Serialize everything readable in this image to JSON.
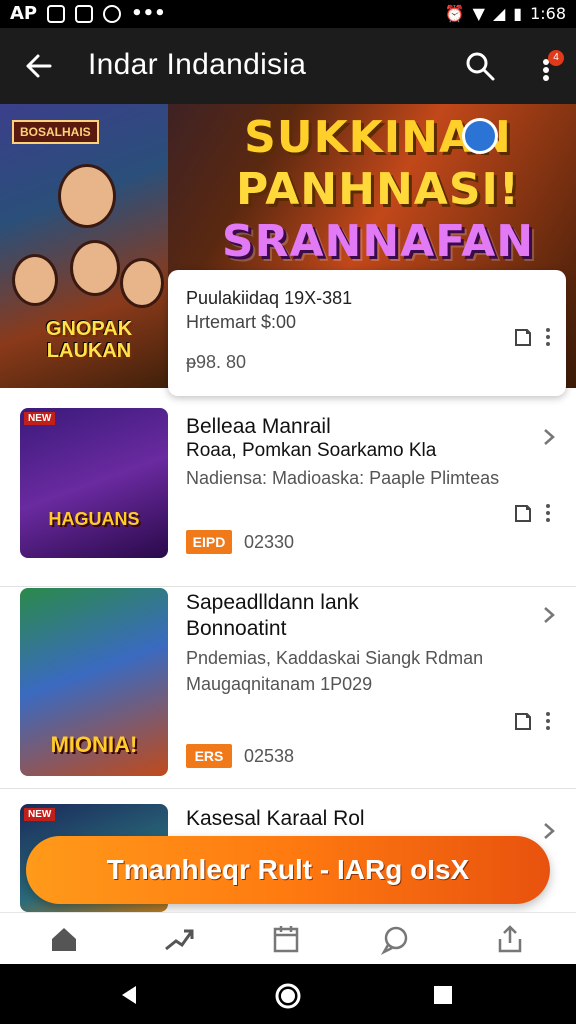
{
  "status_bar": {
    "left_text": "AP",
    "time": "1:68"
  },
  "toolbar": {
    "title": "Indar Indandisia",
    "notification_count": "4"
  },
  "banner": {
    "logo_text": "BOSALHAIS",
    "game_title": "GNOPAK LAUKAN",
    "headline_1": "SUKKINAN",
    "headline_2": "PANHNASI!",
    "headline_3": "SRANNAFAN"
  },
  "featured_card": {
    "line1": "Puulakiidaq 19X-381",
    "line2": "Hrtemart $:00",
    "price": "ᵽ98. 80"
  },
  "list": [
    {
      "tag": "NEW",
      "art_title": "HAGUANS",
      "title": "Belleaa Manrail",
      "subtitle_1": "Roaa, Pomkan Soarkamo Kla",
      "subtitle_2": "Nadiensa: Madioaska: Paaple Plimteas",
      "price_tag": "EIPD",
      "price": "02330"
    },
    {
      "tag": "",
      "art_title": "MIONIA!",
      "title": "Sapeadlldann lank",
      "subtitle_1": "Bonnoatint",
      "subtitle_2": "Pndemias, Kaddaskai Siangk Rdman",
      "subtitle_3": "Maugaqnitanam 1P029",
      "price_tag": "ERS",
      "price": "02538"
    },
    {
      "tag": "NEW",
      "title": "Kasesal Karaal Rol"
    }
  ],
  "cta": {
    "label": "Tmanhleqr Rult - IARg oIsX"
  },
  "bottom_nav": [
    "home-icon",
    "trending-icon",
    "calendar-icon",
    "chat-icon",
    "share-icon"
  ],
  "colors": {
    "accent": "#f07a1a",
    "toolbar": "#1c1c1c"
  }
}
